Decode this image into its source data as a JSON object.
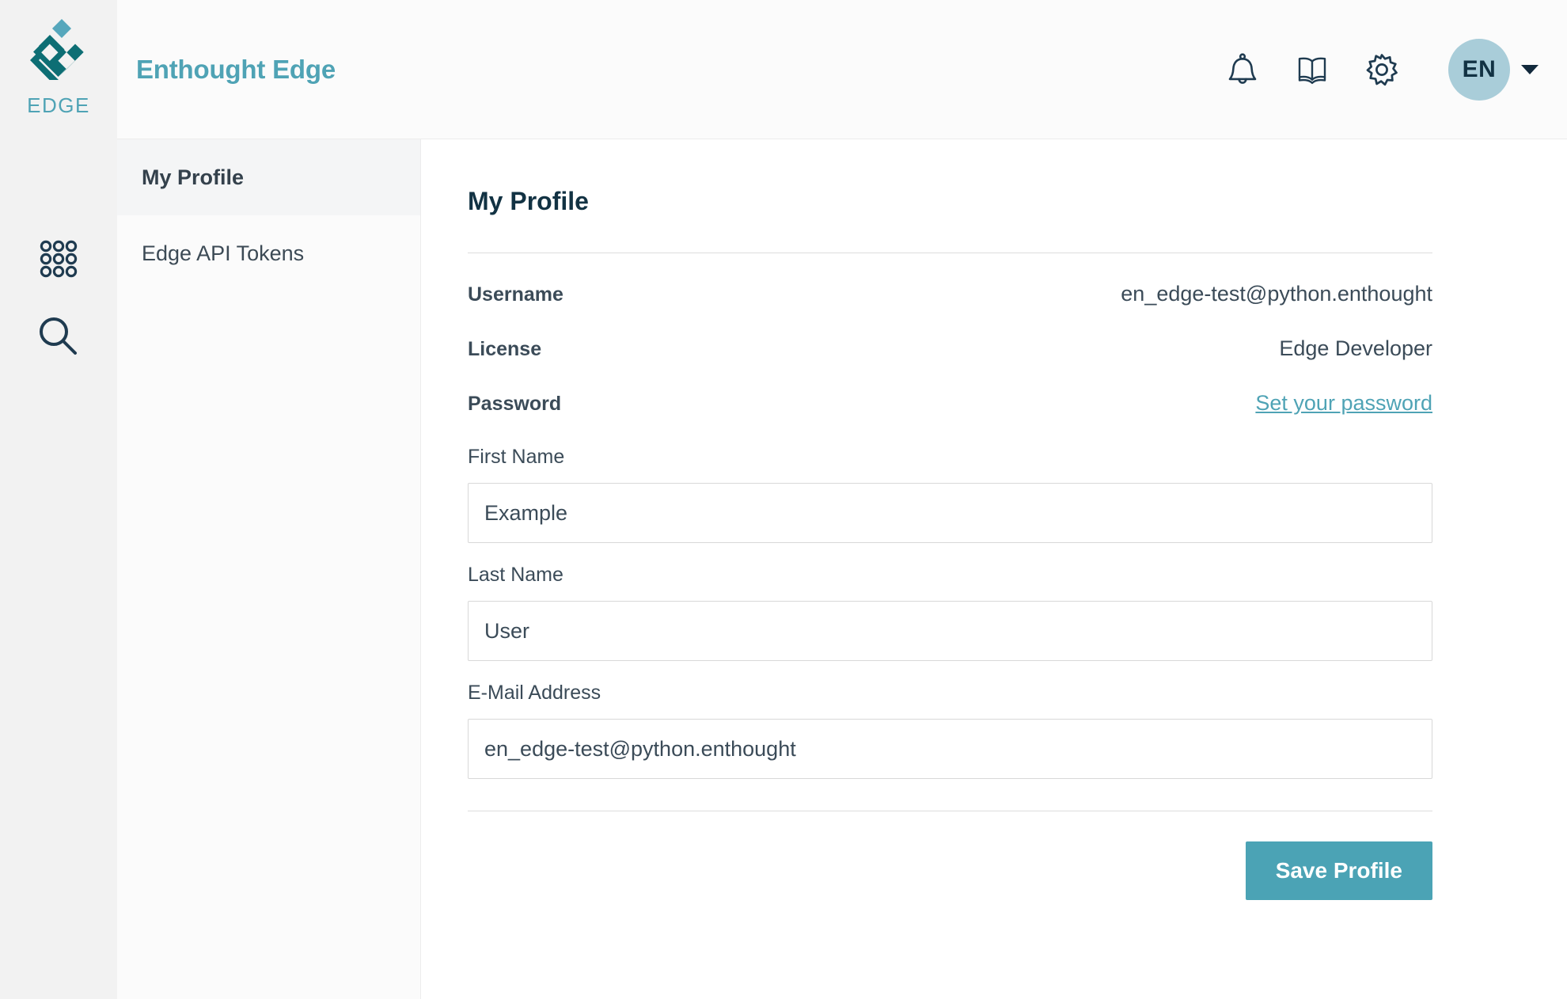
{
  "brand": {
    "wordmark": "EDGE",
    "logo_icon": "edge-diamond-logo",
    "logo_color": "#0d6e74",
    "logo_accent_color": "#56a7bc",
    "accent_color": "#4FA3B5"
  },
  "header": {
    "title": "Enthought Edge",
    "icons": [
      {
        "name": "notifications-icon",
        "glyph": "bell"
      },
      {
        "name": "documentation-icon",
        "glyph": "open-book"
      },
      {
        "name": "settings-icon",
        "glyph": "gear"
      }
    ],
    "avatar": {
      "initials": "EN",
      "background_color": "#a9cdd9",
      "text_color": "#123243",
      "caret_icon": "chevron-down-icon"
    }
  },
  "rail": {
    "icons": [
      {
        "name": "apps-grid-icon",
        "glyph": "grid-3x3-circles"
      },
      {
        "name": "search-icon",
        "glyph": "magnifier"
      }
    ]
  },
  "subnav": {
    "items": [
      {
        "label": "My Profile",
        "active": true
      },
      {
        "label": "Edge API Tokens",
        "active": false
      }
    ]
  },
  "main": {
    "page_title": "My Profile",
    "info_rows": [
      {
        "label": "Username",
        "value": "en_edge-test@python.enthought",
        "is_link": false
      },
      {
        "label": "License",
        "value": "Edge Developer",
        "is_link": false
      },
      {
        "label": "Password",
        "value": "Set your password",
        "is_link": true
      }
    ],
    "fields": [
      {
        "label": "First Name",
        "value": "Example",
        "placeholder": ""
      },
      {
        "label": "Last Name",
        "value": "User",
        "placeholder": ""
      },
      {
        "label": "E-Mail Address",
        "value": "en_edge-test@python.enthought",
        "placeholder": ""
      }
    ],
    "save_button": "Save Profile"
  }
}
